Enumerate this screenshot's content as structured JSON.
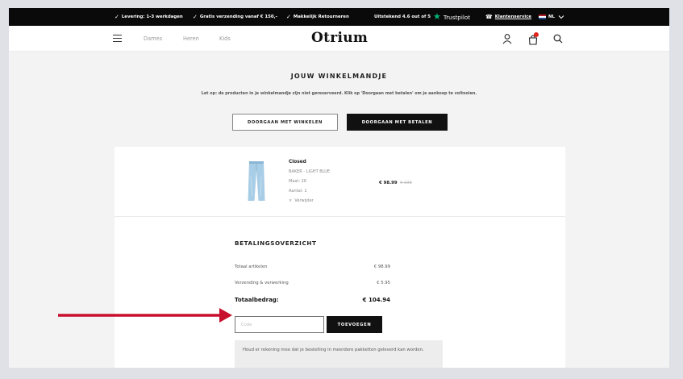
{
  "topbar": {
    "delivery": "Levering: 1-3 werkdagen",
    "free_shipping": "Gratis verzending vanaf € 150,-",
    "returns": "Makkelijk Retourneren",
    "rating": "Uitstekend  4.6 out of 5",
    "trustpilot": "Trustpilot",
    "service": "Klantenservice",
    "language": "NL"
  },
  "header": {
    "nav": [
      "Dames",
      "Heren",
      "Kids"
    ],
    "logo": "Otrium"
  },
  "cart": {
    "title": "JOUW WINKELMANDJE",
    "notice": "Let op: de producten in je winkelmandje zijn niet gereserveerd. Klik op 'Doorgaan met betalen' om je aankoop te voltooien.",
    "continue_shopping": "DOORGAAN MET WINKELEN",
    "checkout": "DOORGAAN MET BETALEN"
  },
  "product": {
    "brand": "Closed",
    "name": "BAKER - LIGHT BLUE",
    "size": "Maat: 26",
    "quantity": "Aantal: 1",
    "remove": "Verwijder",
    "price": "€ 98.99",
    "old_price": "€ 199"
  },
  "summary": {
    "title": "BETALINGSOVERZICHT",
    "items_label": "Totaal artikelen",
    "items_value": "€ 98.99",
    "shipping_label": "Verzending & verwerking",
    "shipping_value": "€ 5.95",
    "total_label": "Totaalbedrag:",
    "total_value": "€ 104.94",
    "code_placeholder": "Code",
    "add_button": "TOEVOEGEN",
    "info": "Houd er rekening mee dat je bestelling in meerdere pakketten geleverd kan worden."
  },
  "colors": {
    "annotation_arrow": "#c8102e",
    "trustpilot_green": "#00b67a",
    "badge": "#e1241b"
  }
}
